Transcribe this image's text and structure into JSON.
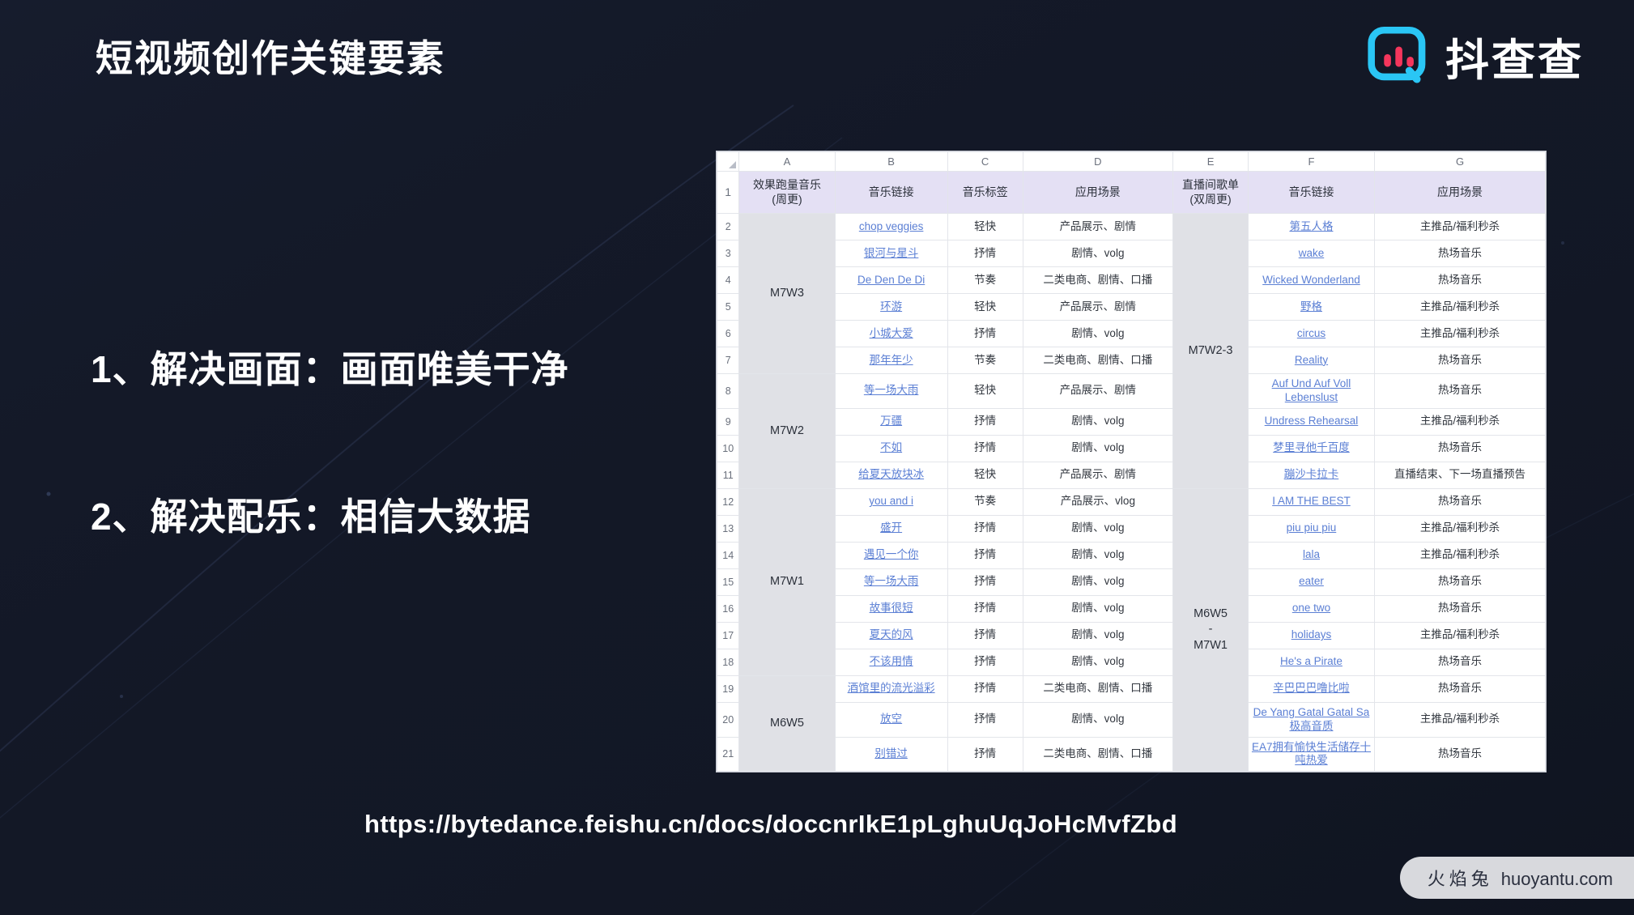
{
  "slide": {
    "title": "短视频创作关键要素",
    "background_color": "#131827",
    "bullets": [
      "1、解决画面：画面唯美干净",
      "2、解决配乐：相信大数据"
    ],
    "doc_url": "https://bytedance.feishu.cn/docs/doccnrIkE1pLghuUqJoHcMvfZbd"
  },
  "brand": {
    "wordmark": "抖查查",
    "logo_body_color": "#2ac6f5",
    "logo_bar_color": "#f5365c"
  },
  "watermark": {
    "cn": "火焰兔",
    "domain": "huoyantu.com"
  },
  "sheet": {
    "column_letters": [
      "A",
      "B",
      "C",
      "D",
      "E",
      "F",
      "G"
    ],
    "headers": {
      "a": "效果跑量音乐\n(周更)",
      "a_line1": "效果跑量音乐",
      "a_line2": "(周更)",
      "b": "音乐链接",
      "c": "音乐标签",
      "d": "应用场景",
      "e_line1": "直播间歌单",
      "e_line2": "(双周更)",
      "f": "音乐链接",
      "g": "应用场景"
    },
    "groups_a": [
      {
        "label": "M7W3",
        "rows": 6
      },
      {
        "label": "M7W2",
        "rows": 4
      },
      {
        "label": "M7W1",
        "rows": 7
      },
      {
        "label": "M6W5",
        "rows": 3
      }
    ],
    "groups_e": [
      {
        "label": "M7W2-3",
        "rows": 10
      },
      {
        "label": "M6W5\n-\nM7W1",
        "label_l1": "M6W5",
        "label_l2": "-",
        "label_l3": "M7W1",
        "rows": 10
      }
    ],
    "rows": [
      {
        "n": "2",
        "b": "chop veggies",
        "c": "轻快",
        "d": "产品展示、剧情",
        "f": "第五人格",
        "g": "主推品/福利秒杀"
      },
      {
        "n": "3",
        "b": "银河与星斗",
        "c": "抒情",
        "d": "剧情、volg",
        "f": "wake",
        "g": "热场音乐"
      },
      {
        "n": "4",
        "b": "De Den De Di",
        "c": "节奏",
        "d": "二类电商、剧情、口播",
        "f": "Wicked Wonderland",
        "g": "热场音乐"
      },
      {
        "n": "5",
        "b": "环游",
        "c": "轻快",
        "d": "产品展示、剧情",
        "f": "野格",
        "g": "主推品/福利秒杀"
      },
      {
        "n": "6",
        "b": "小城大爱",
        "c": "抒情",
        "d": "剧情、volg",
        "f": "circus",
        "g": "主推品/福利秒杀"
      },
      {
        "n": "7",
        "b": "那年年少",
        "c": "节奏",
        "d": "二类电商、剧情、口播",
        "f": "Reality",
        "g": "热场音乐"
      },
      {
        "n": "8",
        "b": "等一场大雨",
        "c": "轻快",
        "d": "产品展示、剧情",
        "f": "Auf Und Auf Voll Lebenslust",
        "g": "热场音乐"
      },
      {
        "n": "9",
        "b": "万疆",
        "c": "抒情",
        "d": "剧情、volg",
        "f": "Undress Rehearsal",
        "g": "主推品/福利秒杀"
      },
      {
        "n": "10",
        "b": "不如",
        "c": "抒情",
        "d": "剧情、volg",
        "f": "梦里寻他千百度",
        "g": "热场音乐"
      },
      {
        "n": "11",
        "b": "给夏天放块冰",
        "c": "轻快",
        "d": "产品展示、剧情",
        "f": "蹦沙卡拉卡",
        "g": "直播结束、下一场直播预告"
      },
      {
        "n": "12",
        "b": "you and i",
        "c": "节奏",
        "d": "产品展示、vlog",
        "f": "I AM THE BEST",
        "g": "热场音乐"
      },
      {
        "n": "13",
        "b": "盛开",
        "c": "抒情",
        "d": "剧情、volg",
        "f": "piu piu piu",
        "g": "主推品/福利秒杀"
      },
      {
        "n": "14",
        "b": "遇见一个你",
        "c": "抒情",
        "d": "剧情、volg",
        "f": "lala",
        "g": "主推品/福利秒杀"
      },
      {
        "n": "15",
        "b": "等一场大雨",
        "c": "抒情",
        "d": "剧情、volg",
        "f": "eater",
        "g": "热场音乐"
      },
      {
        "n": "16",
        "b": "故事很短",
        "c": "抒情",
        "d": "剧情、volg",
        "f": "one two",
        "g": "热场音乐"
      },
      {
        "n": "17",
        "b": "夏天的风",
        "c": "抒情",
        "d": "剧情、volg",
        "f": "holidays",
        "g": "主推品/福利秒杀"
      },
      {
        "n": "18",
        "b": "不该用情",
        "c": "抒情",
        "d": "剧情、volg",
        "f": "He's a Pirate",
        "g": "热场音乐"
      },
      {
        "n": "19",
        "b": "酒馆里的流光溢彩",
        "c": "抒情",
        "d": "二类电商、剧情、口播",
        "f": "辛巴巴巴噜比啦",
        "g": "热场音乐"
      },
      {
        "n": "20",
        "b": "放空",
        "c": "抒情",
        "d": "剧情、volg",
        "f": "De Yang Gatal Gatal Sa 极高音质",
        "g": "主推品/福利秒杀"
      },
      {
        "n": "21",
        "b": "别错过",
        "c": "抒情",
        "d": "二类电商、剧情、口播",
        "f": "EA7拥有愉快生活储存十吨热爱",
        "g": "热场音乐"
      }
    ]
  }
}
